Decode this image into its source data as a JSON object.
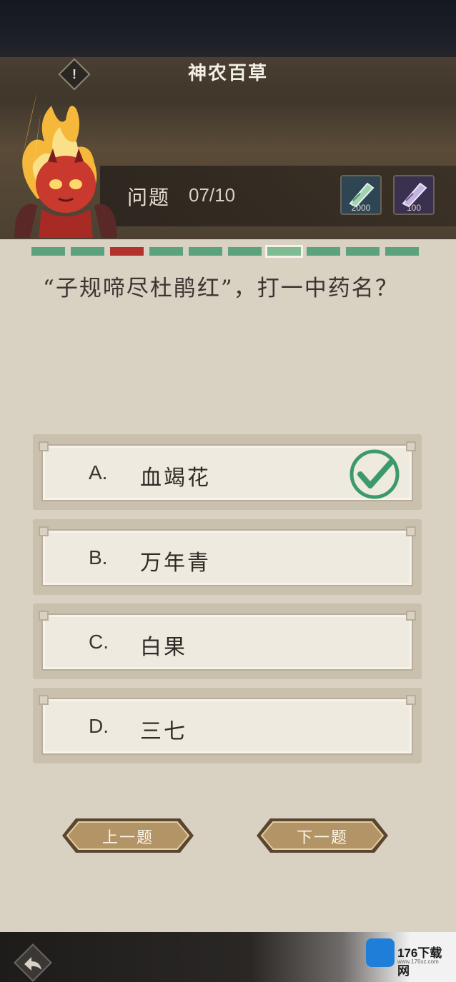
{
  "header": {
    "title": "神农百草",
    "warn_symbol": "!",
    "question_label": "问题",
    "question_count": "07/10",
    "items": [
      {
        "icon": "green-herb-icon",
        "count": "2000"
      },
      {
        "icon": "purple-herb-icon",
        "count": "100"
      }
    ]
  },
  "progress": {
    "segments": [
      "correct",
      "correct",
      "wrong",
      "correct",
      "correct",
      "correct",
      "current",
      "correct",
      "correct",
      "correct"
    ],
    "colors": {
      "correct": "#5aa37d",
      "wrong": "#b3322e"
    }
  },
  "question": {
    "text": "“子规啼尽杜鹃红”，打一中药名？"
  },
  "options": [
    {
      "letter": "A.",
      "text": "血竭花",
      "status": "correct"
    },
    {
      "letter": "B.",
      "text": "万年青",
      "status": ""
    },
    {
      "letter": "C.",
      "text": "白果",
      "status": ""
    },
    {
      "letter": "D.",
      "text": "三七",
      "status": ""
    }
  ],
  "nav": {
    "prev_label": "上一题",
    "next_label": "下一题"
  },
  "footer": {
    "back_icon": "back-arrow-icon",
    "watermark_name": "176下载网",
    "watermark_url": "www.176xz.com"
  }
}
